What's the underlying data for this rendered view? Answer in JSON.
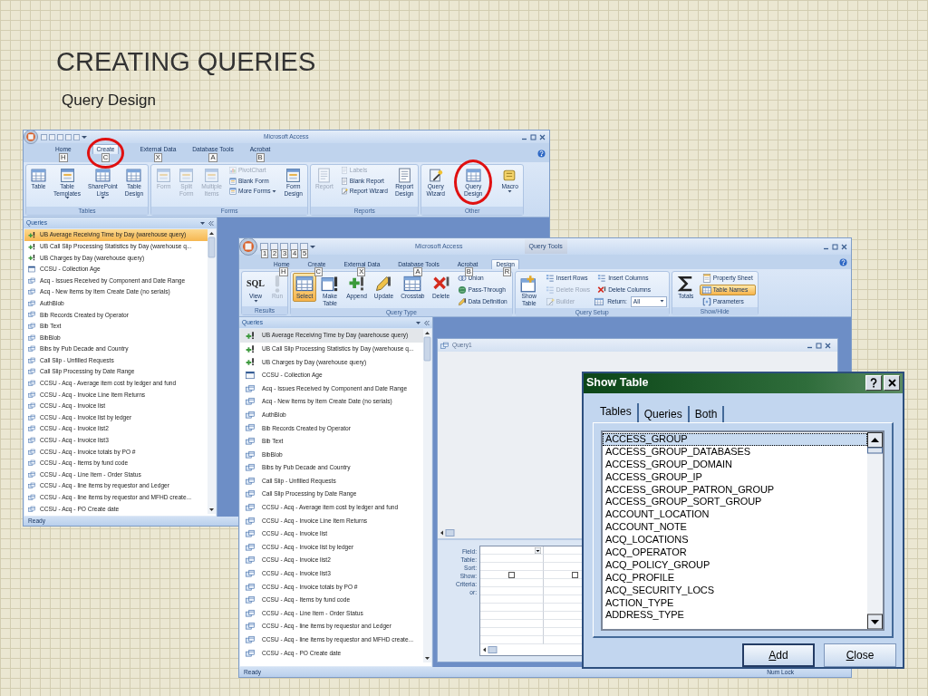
{
  "slide": {
    "title": "CREATING QUERIES",
    "subtitle": "Query Design"
  },
  "windows": [
    {
      "title": "Microsoft Access",
      "tabs": [
        {
          "label": "Home",
          "keytip": "H",
          "selected": false,
          "circled": false
        },
        {
          "label": "Create",
          "keytip": "C",
          "selected": true,
          "circled": true
        },
        {
          "label": "External Data",
          "keytip": "X",
          "selected": false,
          "circled": false
        },
        {
          "label": "Database Tools",
          "keytip": "A",
          "selected": false,
          "circled": false
        },
        {
          "label": "Acrobat",
          "keytip": "B",
          "selected": false,
          "circled": false
        }
      ],
      "groups": [
        {
          "label": "Tables",
          "items": [
            {
              "kind": "large",
              "label": "Table",
              "dropdown": false,
              "disabled": false,
              "selected": false,
              "circled": false
            },
            {
              "kind": "large",
              "label": "Table Templates",
              "dropdown": true,
              "disabled": false,
              "selected": false,
              "circled": false
            },
            {
              "kind": "large",
              "label": "SharePoint Lists",
              "dropdown": true,
              "disabled": false,
              "selected": false,
              "circled": false
            },
            {
              "kind": "large",
              "label": "Table Design",
              "dropdown": false,
              "disabled": false,
              "selected": false,
              "circled": false
            }
          ]
        },
        {
          "label": "Forms",
          "items": [
            {
              "kind": "large",
              "label": "Form",
              "dropdown": false,
              "disabled": true,
              "selected": false,
              "circled": false
            },
            {
              "kind": "large",
              "label": "Split Form",
              "dropdown": false,
              "disabled": true,
              "selected": false,
              "circled": false
            },
            {
              "kind": "large",
              "label": "Multiple Items",
              "dropdown": false,
              "disabled": true,
              "selected": false,
              "circled": false
            },
            {
              "kind": "stack",
              "items": [
                {
                  "label": "PivotChart",
                  "dropdown": false,
                  "disabled": true,
                  "selected": false,
                  "circled": false
                },
                {
                  "label": "Blank Form",
                  "dropdown": false,
                  "disabled": false,
                  "selected": false,
                  "circled": false
                },
                {
                  "label": "More Forms",
                  "dropdown": true,
                  "disabled": false,
                  "selected": false,
                  "circled": false
                }
              ]
            },
            {
              "kind": "large",
              "label": "Form Design",
              "dropdown": false,
              "disabled": false,
              "selected": false,
              "circled": false
            }
          ]
        },
        {
          "label": "Reports",
          "items": [
            {
              "kind": "large",
              "label": "Report",
              "dropdown": false,
              "disabled": true,
              "selected": false,
              "circled": false
            },
            {
              "kind": "stack",
              "items": [
                {
                  "label": "Labels",
                  "dropdown": false,
                  "disabled": true,
                  "selected": false,
                  "circled": false
                },
                {
                  "label": "Blank Report",
                  "dropdown": false,
                  "disabled": false,
                  "selected": false,
                  "circled": false
                },
                {
                  "label": "Report Wizard",
                  "dropdown": false,
                  "disabled": false,
                  "selected": false,
                  "circled": false
                }
              ]
            },
            {
              "kind": "large",
              "label": "Report Design",
              "dropdown": false,
              "disabled": false,
              "selected": false,
              "circled": false
            }
          ]
        },
        {
          "label": "Other",
          "items": [
            {
              "kind": "large",
              "label": "Query Wizard",
              "dropdown": false,
              "disabled": false,
              "selected": false,
              "circled": false
            },
            {
              "kind": "large",
              "label": "Query Design",
              "dropdown": false,
              "disabled": false,
              "selected": false,
              "circled": true
            },
            {
              "kind": "large",
              "label": "Macro",
              "dropdown": true,
              "disabled": false,
              "selected": false,
              "circled": false
            }
          ]
        }
      ],
      "nav": {
        "title": "Queries",
        "focused": true,
        "items": [
          {
            "label": "UB Average Receiving Time by Day (warehouse query)",
            "kind": "action",
            "selected": true
          },
          {
            "label": "UB Call Slip Processing Statistics by Day (warehouse q...",
            "kind": "action",
            "selected": false
          },
          {
            "label": "UB Charges by Day (warehouse query)",
            "kind": "action",
            "selected": false
          },
          {
            "label": "CCSU - Collection Age",
            "kind": "form",
            "selected": false
          },
          {
            "label": "Acq - Issues Received by Component and Date Range",
            "kind": "query",
            "selected": false
          },
          {
            "label": "Acq - New Items by Item Create Date (no serials)",
            "kind": "query",
            "selected": false
          },
          {
            "label": "AuthBlob",
            "kind": "query",
            "selected": false
          },
          {
            "label": "Bib Records Created by Operator",
            "kind": "query",
            "selected": false
          },
          {
            "label": "Bib Text",
            "kind": "query",
            "selected": false
          },
          {
            "label": "BibBlob",
            "kind": "query",
            "selected": false
          },
          {
            "label": "Bibs by Pub Decade and Country",
            "kind": "query",
            "selected": false
          },
          {
            "label": "Call Slip - Unfilled Requests",
            "kind": "query",
            "selected": false
          },
          {
            "label": "Call Slip Processing by Date Range",
            "kind": "query",
            "selected": false
          },
          {
            "label": "CCSU - Acq - Average item cost by ledger and fund",
            "kind": "query",
            "selected": false
          },
          {
            "label": "CCSU - Acq - Invoice Line Item Returns",
            "kind": "query",
            "selected": false
          },
          {
            "label": "CCSU - Acq - Invoice list",
            "kind": "query",
            "selected": false
          },
          {
            "label": "CCSU - Acq - Invoice list by ledger",
            "kind": "query",
            "selected": false
          },
          {
            "label": "CCSU - Acq - Invoice list2",
            "kind": "query",
            "selected": false
          },
          {
            "label": "CCSU - Acq - Invoice list3",
            "kind": "query",
            "selected": false
          },
          {
            "label": "CCSU - Acq - Invoice totals by PO #",
            "kind": "query",
            "selected": false
          },
          {
            "label": "CCSU - Acq - Items by fund code",
            "kind": "query",
            "selected": false
          },
          {
            "label": "CCSU - Acq - Line Item - Order Status",
            "kind": "query",
            "selected": false
          },
          {
            "label": "CCSU - Acq - line items by requestor and Ledger",
            "kind": "query",
            "selected": false
          },
          {
            "label": "CCSU - Acq - line items by requestor and MFHD create...",
            "kind": "query",
            "selected": false
          },
          {
            "label": "CCSU - Acq - PO Create date",
            "kind": "query",
            "selected": false
          }
        ]
      },
      "status": [
        "Ready"
      ]
    },
    {
      "title": "Microsoft Access",
      "context_tab": "Query Tools",
      "quick_access_keytips": [
        "1",
        "2",
        "3",
        "4",
        "5"
      ],
      "tabs": [
        {
          "label": "Home",
          "keytip": "H",
          "selected": false
        },
        {
          "label": "Create",
          "keytip": "C",
          "selected": false
        },
        {
          "label": "External Data",
          "keytip": "X",
          "selected": false
        },
        {
          "label": "Database Tools",
          "keytip": "A",
          "selected": false
        },
        {
          "label": "Acrobat",
          "keytip": "B",
          "selected": false
        },
        {
          "label": "Design",
          "keytip": "R",
          "selected": true
        }
      ],
      "groups": [
        {
          "label": "Results",
          "items": [
            {
              "kind": "large",
              "label": "View",
              "icon_text": "SQL",
              "dropdown": true,
              "disabled": false,
              "selected": false
            },
            {
              "kind": "large",
              "label": "Run",
              "dropdown": false,
              "disabled": true,
              "selected": false
            }
          ]
        },
        {
          "label": "Query Type",
          "items": [
            {
              "kind": "large",
              "label": "Select",
              "dropdown": false,
              "disabled": false,
              "selected": true
            },
            {
              "kind": "large",
              "label": "Make Table",
              "dropdown": false,
              "disabled": false,
              "selected": false
            },
            {
              "kind": "large",
              "label": "Append",
              "dropdown": false,
              "disabled": false,
              "selected": false
            },
            {
              "kind": "large",
              "label": "Update",
              "dropdown": false,
              "disabled": false,
              "selected": false
            },
            {
              "kind": "large",
              "label": "Crosstab",
              "dropdown": false,
              "disabled": false,
              "selected": false
            },
            {
              "kind": "large",
              "label": "Delete",
              "dropdown": false,
              "disabled": false,
              "selected": false
            },
            {
              "kind": "stack",
              "items": [
                {
                  "label": "Union",
                  "dropdown": false,
                  "disabled": false,
                  "selected": false
                },
                {
                  "label": "Pass-Through",
                  "dropdown": false,
                  "disabled": false,
                  "selected": false
                },
                {
                  "label": "Data Definition",
                  "dropdown": false,
                  "disabled": false,
                  "selected": false
                }
              ]
            }
          ]
        },
        {
          "label": "Query Setup",
          "items": [
            {
              "kind": "large",
              "label": "Show Table",
              "dropdown": false,
              "disabled": false,
              "selected": false
            },
            {
              "kind": "stack",
              "items": [
                {
                  "label": "Insert Rows",
                  "dropdown": false,
                  "disabled": false,
                  "selected": false
                },
                {
                  "label": "Delete Rows",
                  "dropdown": false,
                  "disabled": true,
                  "selected": false
                },
                {
                  "label": "Builder",
                  "dropdown": false,
                  "disabled": true,
                  "selected": false
                }
              ]
            },
            {
              "kind": "stack",
              "items": [
                {
                  "label": "Insert Columns",
                  "dropdown": false,
                  "disabled": false,
                  "selected": false
                },
                {
                  "label": "Delete Columns",
                  "dropdown": false,
                  "disabled": false,
                  "selected": false
                },
                {
                  "kind": "select",
                  "label": "Return:",
                  "value": "All",
                  "disabled": false,
                  "selected": false
                }
              ]
            }
          ]
        },
        {
          "label": "Show/Hide",
          "items": [
            {
              "kind": "large",
              "label": "Totals",
              "dropdown": false,
              "disabled": false,
              "selected": false
            },
            {
              "kind": "stack",
              "items": [
                {
                  "label": "Property Sheet",
                  "dropdown": false,
                  "disabled": false,
                  "selected": false
                },
                {
                  "label": "Table Names",
                  "dropdown": false,
                  "disabled": false,
                  "selected": true
                },
                {
                  "label": "Parameters",
                  "dropdown": false,
                  "disabled": false,
                  "selected": false
                }
              ]
            }
          ]
        }
      ],
      "nav": {
        "title": "Queries",
        "focused": false,
        "items": [
          {
            "label": "UB Average Receiving Time by Day (warehouse query)",
            "kind": "action",
            "selected": true
          },
          {
            "label": "UB Call Slip Processing Statistics by Day (warehouse q...",
            "kind": "action",
            "selected": false
          },
          {
            "label": "UB Charges by Day (warehouse query)",
            "kind": "action",
            "selected": false
          },
          {
            "label": "CCSU - Collection Age",
            "kind": "form",
            "selected": false
          },
          {
            "label": "Acq - Issues Received by Component and Date Range",
            "kind": "query",
            "selected": false
          },
          {
            "label": "Acq - New Items by Item Create Date (no serials)",
            "kind": "query",
            "selected": false
          },
          {
            "label": "AuthBlob",
            "kind": "query",
            "selected": false
          },
          {
            "label": "Bib Records Created by Operator",
            "kind": "query",
            "selected": false
          },
          {
            "label": "Bib Text",
            "kind": "query",
            "selected": false
          },
          {
            "label": "BibBlob",
            "kind": "query",
            "selected": false
          },
          {
            "label": "Bibs by Pub Decade and Country",
            "kind": "query",
            "selected": false
          },
          {
            "label": "Call Slip - Unfilled Requests",
            "kind": "query",
            "selected": false
          },
          {
            "label": "Call Slip Processing by Date Range",
            "kind": "query",
            "selected": false
          },
          {
            "label": "CCSU - Acq - Average item cost by ledger and fund",
            "kind": "query",
            "selected": false
          },
          {
            "label": "CCSU - Acq - Invoice Line Item Returns",
            "kind": "query",
            "selected": false
          },
          {
            "label": "CCSU - Acq - Invoice list",
            "kind": "query",
            "selected": false
          },
          {
            "label": "CCSU - Acq - Invoice list by ledger",
            "kind": "query",
            "selected": false
          },
          {
            "label": "CCSU - Acq - Invoice list2",
            "kind": "query",
            "selected": false
          },
          {
            "label": "CCSU - Acq - Invoice list3",
            "kind": "query",
            "selected": false
          },
          {
            "label": "CCSU - Acq - Invoice totals by PO #",
            "kind": "query",
            "selected": false
          },
          {
            "label": "CCSU - Acq - Items by fund code",
            "kind": "query",
            "selected": false
          },
          {
            "label": "CCSU - Acq - Line Item - Order Status",
            "kind": "query",
            "selected": false
          },
          {
            "label": "CCSU - Acq - line items by requestor and Ledger",
            "kind": "query",
            "selected": false
          },
          {
            "label": "CCSU - Acq - line items by requestor and MFHD create...",
            "kind": "query",
            "selected": false
          },
          {
            "label": "CCSU - Acq - PO Create date",
            "kind": "query",
            "selected": false
          }
        ]
      },
      "document": {
        "title": "Query1",
        "row_labels": [
          "Field:",
          "Table:",
          "Sort:",
          "Show:",
          "Criteria:",
          "or:"
        ],
        "columns": [
          {
            "show": false
          },
          {
            "show": false
          }
        ]
      },
      "status": [
        "Ready",
        "Num Lock"
      ]
    }
  ],
  "dialog": {
    "title": "Show Table",
    "tabs": [
      {
        "label": "Tables",
        "selected": true
      },
      {
        "label": "Queries",
        "selected": false
      },
      {
        "label": "Both",
        "selected": false
      }
    ],
    "items": [
      {
        "label": "ACCESS_GROUP",
        "selected": true
      },
      {
        "label": "ACCESS_GROUP_DATABASES",
        "selected": false
      },
      {
        "label": "ACCESS_GROUP_DOMAIN",
        "selected": false
      },
      {
        "label": "ACCESS_GROUP_IP",
        "selected": false
      },
      {
        "label": "ACCESS_GROUP_PATRON_GROUP",
        "selected": false
      },
      {
        "label": "ACCESS_GROUP_SORT_GROUP",
        "selected": false
      },
      {
        "label": "ACCOUNT_LOCATION",
        "selected": false
      },
      {
        "label": "ACCOUNT_NOTE",
        "selected": false
      },
      {
        "label": "ACQ_LOCATIONS",
        "selected": false
      },
      {
        "label": "ACQ_OPERATOR",
        "selected": false
      },
      {
        "label": "ACQ_POLICY_GROUP",
        "selected": false
      },
      {
        "label": "ACQ_PROFILE",
        "selected": false
      },
      {
        "label": "ACQ_SECURITY_LOCS",
        "selected": false
      },
      {
        "label": "ACTION_TYPE",
        "selected": false
      },
      {
        "label": "ADDRESS_TYPE",
        "selected": false
      }
    ],
    "buttons": [
      "Add",
      "Close"
    ]
  }
}
